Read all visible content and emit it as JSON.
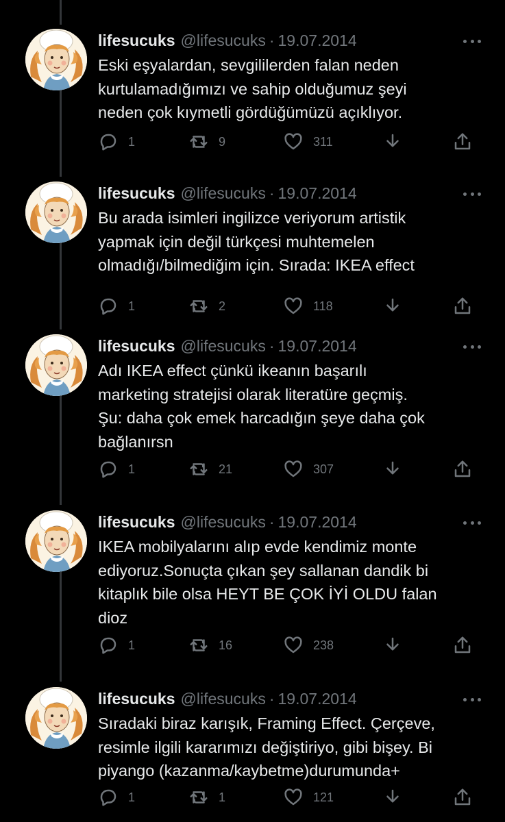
{
  "tweets": [
    {
      "name": "lifesucuks",
      "handle": "@lifesucuks",
      "separator": "·",
      "date": "19.07.2014",
      "text": "Eski eşyalardan, sevgililerden falan neden\nkurtulamadığımızı ve sahip olduğumuz şeyi\nneden çok kıymetli gördüğümüzü açıklıyor.",
      "replies": "1",
      "retweets": "9",
      "likes": "311"
    },
    {
      "name": "lifesucuks",
      "handle": "@lifesucuks",
      "separator": "·",
      "date": "19.07.2014",
      "text": "Bu arada isimleri ingilizce veriyorum artistik\nyapmak için değil türkçesi muhtemelen\nolmadığı/bilmediğim için. Sırada: IKEA effect",
      "replies": "1",
      "retweets": "2",
      "likes": "118"
    },
    {
      "name": "lifesucuks",
      "handle": "@lifesucuks",
      "separator": "·",
      "date": "19.07.2014",
      "text": "Adı IKEA effect çünkü ikeanın başarılı\nmarketing stratejisi olarak literatüre geçmiş.\nŞu: daha çok emek harcadığın şeye daha çok\nbağlanırsn",
      "replies": "1",
      "retweets": "21",
      "likes": "307"
    },
    {
      "name": "lifesucuks",
      "handle": "@lifesucuks",
      "separator": "·",
      "date": "19.07.2014",
      "text": "IKEA mobilyalarını alıp evde kendimiz monte\nediyoruz.Sonuçta çıkan şey sallanan dandik bi\nkitaplık bile olsa HEYT BE ÇOK İYİ OLDU falan\ndioz",
      "replies": "1",
      "retweets": "16",
      "likes": "238"
    },
    {
      "name": "lifesucuks",
      "handle": "@lifesucuks",
      "separator": "·",
      "date": "19.07.2014",
      "text": "Sıradaki biraz karışık, Framing Effect. Çerçeve,\nresimle ilgili kararımızı değiştiriyo, gibi bişey. Bi\npiyango (kazanma/kaybetme)durumunda+",
      "replies": "1",
      "retweets": "1",
      "likes": "121"
    }
  ],
  "icons": {
    "reply": "reply-icon",
    "retweet": "retweet-icon",
    "like": "like-icon",
    "download": "download-icon",
    "share": "share-icon",
    "more": "more-icon"
  },
  "colors": {
    "background": "#000000",
    "text": "#e7e9ea",
    "muted": "#71767b",
    "thread_line": "#333639"
  }
}
